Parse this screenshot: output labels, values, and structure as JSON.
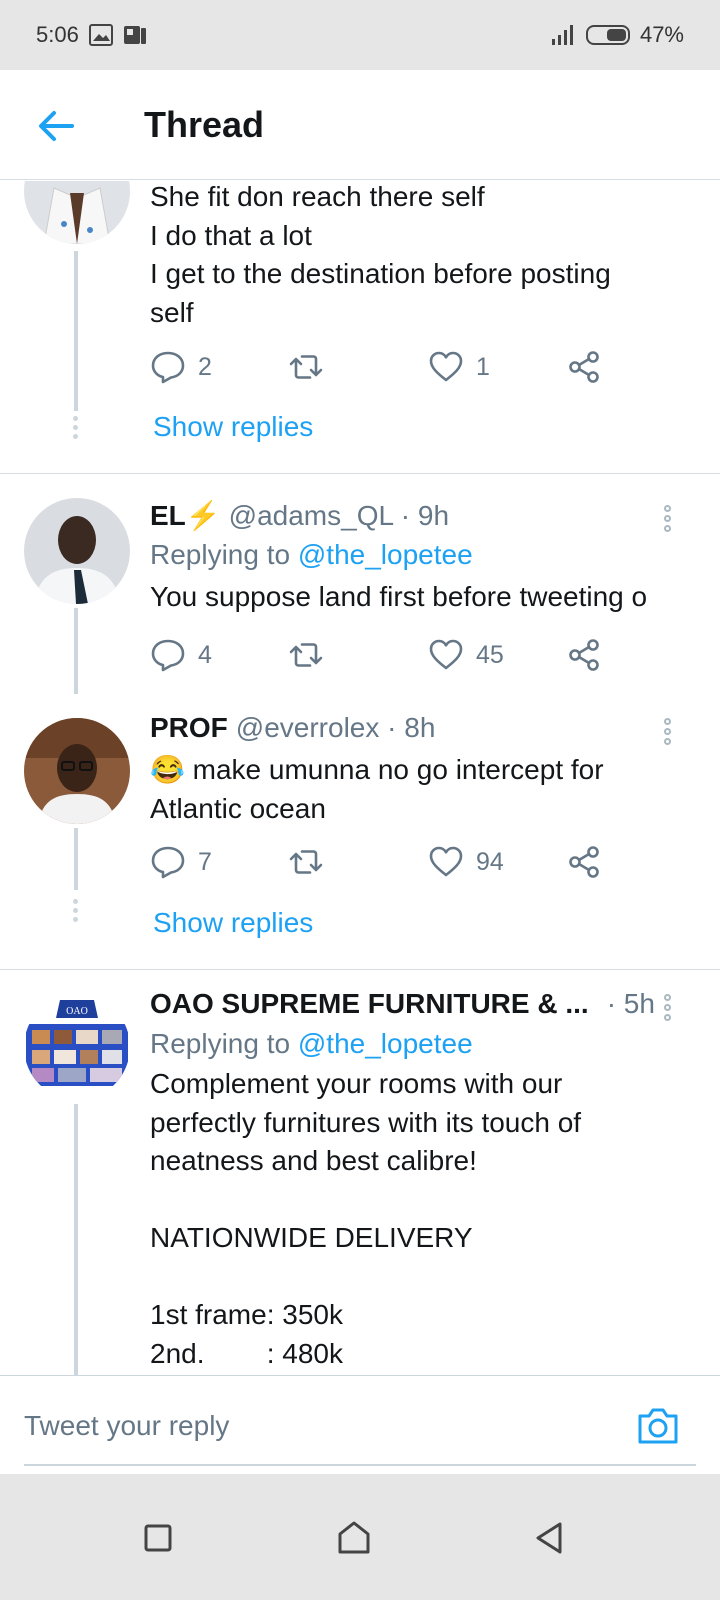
{
  "status_bar": {
    "time": "5:06",
    "battery_text": "47%",
    "battery_level": 0.47
  },
  "header": {
    "title": "Thread"
  },
  "tweets": [
    {
      "lines": "She fit don reach there self\nI do that a lot\nI get to the destination before posting\nself",
      "reply_count": "2",
      "like_count": "1",
      "show_replies": "Show replies"
    },
    {
      "name": "EL⚡",
      "handle": "@adams_QL · 9h",
      "replying_prefix": "Replying to",
      "replying_to": "@the_lopetee",
      "lines": "You suppose land first before tweeting o",
      "reply_count": "4",
      "like_count": "45"
    },
    {
      "name": "PROF",
      "handle": "@everrolex · 8h",
      "lines": "😂 make umunna no go intercept for\nAtlantic ocean",
      "reply_count": "7",
      "like_count": "94",
      "show_replies": "Show replies"
    },
    {
      "name": "OAO SUPREME FURNITURE & ...",
      "handle": "· 5h",
      "replying_prefix": "Replying to",
      "replying_to": "@the_lopetee",
      "lines": "Complement your rooms with our\nperfectly furnitures with its touch of\nneatness and best calibre!\n\nNATIONWIDE DELIVERY\n\n1st frame: 350k\n2nd.        : 480k",
      "avatar_text": "OAO"
    }
  ],
  "reply_bar": {
    "placeholder": "Tweet your reply"
  },
  "icons": [
    "image-icon",
    "news-icon",
    "signal-icon",
    "battery-icon",
    "back-arrow-icon",
    "reply-icon",
    "retweet-icon",
    "like-icon",
    "share-icon",
    "more-icon",
    "camera-icon",
    "recents-icon",
    "home-icon",
    "back-nav-icon"
  ],
  "colors": {
    "accent": "#1da1f2",
    "muted": "#657786",
    "line": "#ccd6dd"
  }
}
